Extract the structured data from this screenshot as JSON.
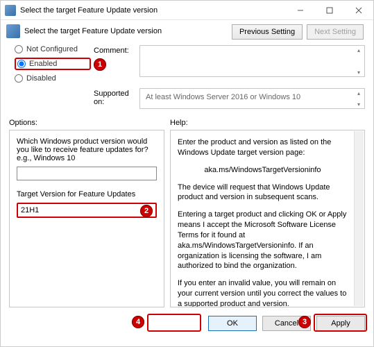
{
  "window": {
    "title": "Select the target Feature Update version"
  },
  "header": {
    "title": "Select the target Feature Update version",
    "prev": "Previous Setting",
    "next": "Next Setting"
  },
  "config": {
    "not_configured": "Not Configured",
    "enabled": "Enabled",
    "disabled": "Disabled",
    "comment_label": "Comment:",
    "comment_value": "",
    "supported_label": "Supported on:",
    "supported_value": "At least Windows Server 2016 or Windows 10"
  },
  "labels": {
    "options": "Options:",
    "help": "Help:"
  },
  "options": {
    "product_label": "Which Windows product version would you like to receive feature updates for? e.g., Windows 10",
    "product_value": "",
    "target_label": "Target Version for Feature Updates",
    "target_value": "21H1"
  },
  "help": {
    "p1": "Enter the product and version as listed on the Windows Update target version page:",
    "link": "aka.ms/WindowsTargetVersioninfo",
    "p2": "The device will request that Windows Update product and version in subsequent scans.",
    "p3": "Entering a target product and clicking OK or Apply means I accept the Microsoft Software License Terms for it found at aka.ms/WindowsTargetVersioninfo. If an organization is licensing the software, I am authorized to bind the organization.",
    "p4": "If you enter an invalid value, you will remain on your current version until you correct the values to a supported product and version."
  },
  "buttons": {
    "ok": "OK",
    "cancel": "Cancel",
    "apply": "Apply"
  },
  "badges": {
    "b1": "1",
    "b2": "2",
    "b3": "3",
    "b4": "4"
  }
}
